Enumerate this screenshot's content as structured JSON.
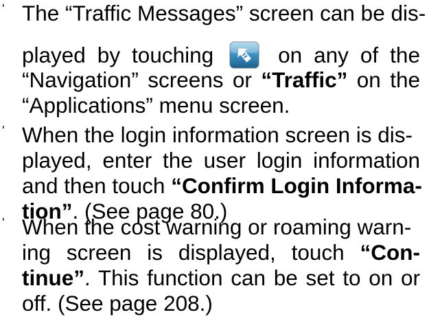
{
  "bullet_mark": "'",
  "items": [
    {
      "l1": "The “Traffic Messages” screen can be dis-",
      "l2_a": "played by touching",
      "l2_b": "on any of the",
      "l3_a": "“Navigation” screens or ",
      "l3_b": "“Traffic”",
      "l3_c": " on the",
      "l4": "“Applications” menu screen.",
      "icon": "traffic-info-icon"
    },
    {
      "l1": "When the login information screen is dis-",
      "l2": "played, enter the user login information",
      "l3_a": "and then touch ",
      "l3_b": "“Confirm Login Informa-",
      "l4_a": "tion”",
      "l4_b": ". (See page 80.)"
    },
    {
      "l1": "When the cost warning or roaming warn-",
      "l2_a": "ing screen is displayed, touch ",
      "l2_b": "“Con-",
      "l3_a": "tinue”",
      "l3_b": ". This function can be set to on or",
      "l4": "off. (See page 208.)"
    }
  ],
  "colors": {
    "text": "#000000",
    "icon_bg": "#2f7fae",
    "icon_arrow": "#ffffff"
  }
}
